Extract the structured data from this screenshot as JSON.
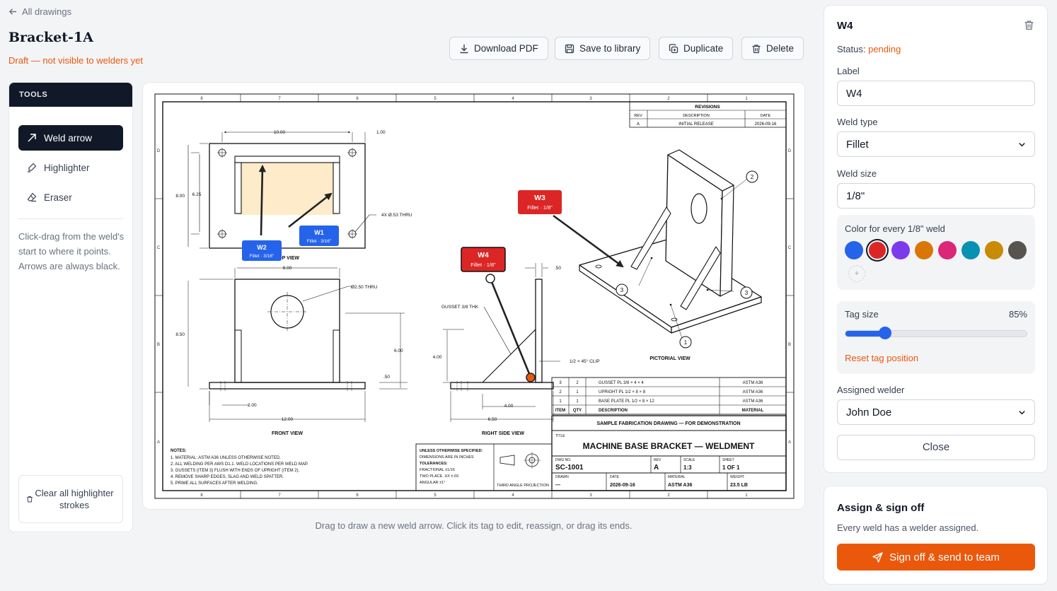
{
  "nav": {
    "back_label": "All drawings"
  },
  "drawing": {
    "name": "Bracket-1A",
    "status_note": "Draft — not visible to welders yet"
  },
  "toolbar": {
    "download_label": "Download PDF",
    "save_label": "Save to library",
    "duplicate_label": "Duplicate",
    "delete_label": "Delete"
  },
  "tools": {
    "heading": "TOOLS",
    "items": [
      {
        "label": "Weld arrow",
        "icon": "arrow-up-right-icon",
        "active": true
      },
      {
        "label": "Highlighter",
        "icon": "highlighter-icon",
        "active": false
      },
      {
        "label": "Eraser",
        "icon": "eraser-icon",
        "active": false
      }
    ],
    "help": "Click-drag from the weld's start to where it points. Arrows are always black.",
    "clear_label": "Clear all highlighter strokes"
  },
  "canvas": {
    "hint": "Drag to draw a new weld arrow. Click its tag to edit, reassign, or drag its ends."
  },
  "weld_tags": [
    {
      "id": "W1",
      "spec": "Fillet · 3/16\"",
      "color": "#2563eb"
    },
    {
      "id": "W2",
      "spec": "Fillet · 3/16\"",
      "color": "#2563eb"
    },
    {
      "id": "W3",
      "spec": "Fillet · 1/8\"",
      "color": "#dc2626"
    },
    {
      "id": "W4",
      "spec": "Fillet · 1/8\"",
      "color": "#dc2626"
    }
  ],
  "sheet": {
    "border_letters_cols": [
      "8",
      "7",
      "6",
      "5",
      "4",
      "3",
      "2",
      "1"
    ],
    "border_letters_rows": [
      "D",
      "C",
      "B",
      "A"
    ],
    "revisions": {
      "heading": "REVISIONS",
      "cols": [
        "REV",
        "DESCRIPTION",
        "DATE"
      ],
      "row": [
        "A",
        "INITIAL RELEASE",
        "2026-09-16"
      ]
    },
    "views": {
      "top": "TOP VIEW",
      "front": "FRONT VIEW",
      "side": "RIGHT SIDE VIEW",
      "pictorial": "PICTORIAL VIEW"
    },
    "dims": {
      "d1": "10.00",
      "d2": "1.00",
      "d3": "8.00",
      "d4": "6.25",
      "d5": "4X Ø.53 THRU",
      "d6": "8.00",
      "d7": "Ø2.50 THRU",
      "d8": "8.50",
      "d9": "6.00",
      "d10": ".50",
      "d11": "2.00",
      "d12": "12.00",
      "d13": ".50",
      "d14": "GUSSET 3/8 THK",
      "d15": "4.00",
      "d16": "1/2 × 45° CLIP",
      "d17": "4.00",
      "d18": "6.50"
    },
    "balloons": [
      "2",
      "3",
      "3",
      "1"
    ],
    "bom": {
      "rows": [
        [
          "3",
          "2",
          "GUSSET PL 3/8 × 4 × 4",
          "ASTM A36"
        ],
        [
          "2",
          "1",
          "UPRIGHT PL 1/2 × 8 × 8",
          "ASTM A36"
        ],
        [
          "1",
          "1",
          "BASE PLATE PL 1/2 × 8 × 12",
          "ASTM A36"
        ]
      ],
      "header": [
        "ITEM",
        "QTY",
        "DESCRIPTION",
        "MATERIAL"
      ]
    },
    "title_block": {
      "banner": "SAMPLE FABRICATION DRAWING — FOR DEMONSTRATION",
      "title_label": "TITLE",
      "title": "MACHINE BASE BRACKET — WELDMENT",
      "dwg_label": "DWG NO.",
      "dwg": "SC-1001",
      "rev_label": "REV",
      "rev": "A",
      "scale_label": "SCALE",
      "scale": "1:3",
      "sheet_label": "SHEET",
      "sheet": "1 OF 1",
      "drawn_label": "DRAWN",
      "drawn": "—",
      "date_label": "DATE",
      "date": "2026-09-16",
      "material_label": "MATERIAL",
      "material": "ASTM A36",
      "weight_label": "WEIGHT",
      "weight": "23.5 LB"
    },
    "notes": {
      "heading": "NOTES:",
      "lines": [
        "1. MATERIAL: ASTM A36 UNLESS OTHERWISE NOTED.",
        "2. ALL WELDING PER AWS D1.1. WELD LOCATIONS PER WELD MAP.",
        "3. GUSSETS (ITEM 3) FLUSH WITH ENDS OF UPRIGHT (ITEM 2).",
        "4. REMOVE SHARP EDGES, SLAG AND WELD SPATTER.",
        "5. PRIME ALL SURFACES AFTER WELDING."
      ]
    },
    "tolerances": {
      "heading": "UNLESS OTHERWISE SPECIFIED:",
      "l1": "DIMENSIONS ARE IN INCHES",
      "l2": "TOLERANCES:",
      "l3": "FRACTIONAL ±1/16",
      "l4": "TWO PLACE .XX ±.03",
      "l5": "ANGULAR ±1°",
      "projection": "THIRD ANGLE PROJECTION"
    }
  },
  "weld_panel": {
    "title": "W4",
    "status_label": "Status:",
    "status_value": "pending",
    "label_label": "Label",
    "label_value": "W4",
    "type_label": "Weld type",
    "type_value": "Fillet",
    "size_label": "Weld size",
    "size_value": "1/8\"",
    "color_label": "Color for every 1/8\" weld",
    "colors": [
      "#2563eb",
      "#dc2626",
      "#7c3aed",
      "#d97706",
      "#db2777",
      "#0891b2",
      "#ca8a04",
      "#57534e"
    ],
    "selected_color": "#dc2626",
    "add_color": "+",
    "tag_size_label": "Tag size",
    "tag_size_value": "85%",
    "tag_size_fraction": 0.22,
    "reset_label": "Reset tag position",
    "welder_label": "Assigned welder",
    "welder_value": "John Doe",
    "close_label": "Close"
  },
  "assign": {
    "title": "Assign & sign off",
    "subtitle": "Every weld has a welder assigned.",
    "button_label": "Sign off & send to team"
  }
}
